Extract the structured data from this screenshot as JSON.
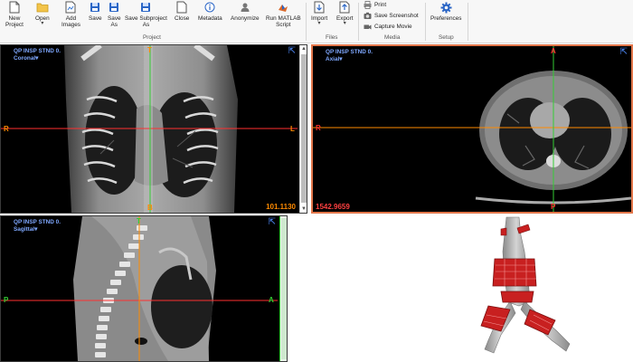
{
  "toolbar": {
    "new_project": "New\nProject",
    "open": "Open",
    "add_images": "Add\nImages",
    "save": "Save",
    "save_as": "Save\nAs",
    "save_subproject_as": "Save Subproject\nAs",
    "close": "Close",
    "metadata": "Metadata",
    "anonymize": "Anonymize",
    "run_matlab": "Run MATLAB\nScript",
    "import": "Import",
    "export": "Export",
    "print": "Print",
    "save_screenshot": "Save Screenshot",
    "capture_movie": "Capture Movie",
    "preferences": "Preferences",
    "dropdown_glyph": "▾",
    "groups": {
      "project": "Project",
      "files": "Files",
      "media": "Media",
      "setup": "Setup"
    }
  },
  "viewports": {
    "coronal": {
      "title": "QP INSP STND 0.",
      "orientation": "Coronal▾",
      "top": "T",
      "bottom": "B",
      "left": "R",
      "right": "L",
      "window_value": "101.1130",
      "expand_icon": "⇱"
    },
    "axial": {
      "title": "QP INSP STND 0.",
      "orientation": "Axial▾",
      "top": "A",
      "bottom": "P",
      "left": "R",
      "window_value": "1542.9659",
      "expand_icon": "⇱"
    },
    "sagittal": {
      "title": "QP INSP STND 0.",
      "orientation": "Sagittal▾",
      "top": "T",
      "left": "P",
      "right": "A",
      "expand_icon": "⇱"
    }
  },
  "colors": {
    "accent_blue": "#1f6fd1",
    "crosshair_red": "#ff3030",
    "crosshair_green": "#33cc33",
    "crosshair_orange": "#ff8a00",
    "axial_frame": "#e2764a",
    "model_gray": "#b5b5b5",
    "model_red": "#c82020"
  }
}
